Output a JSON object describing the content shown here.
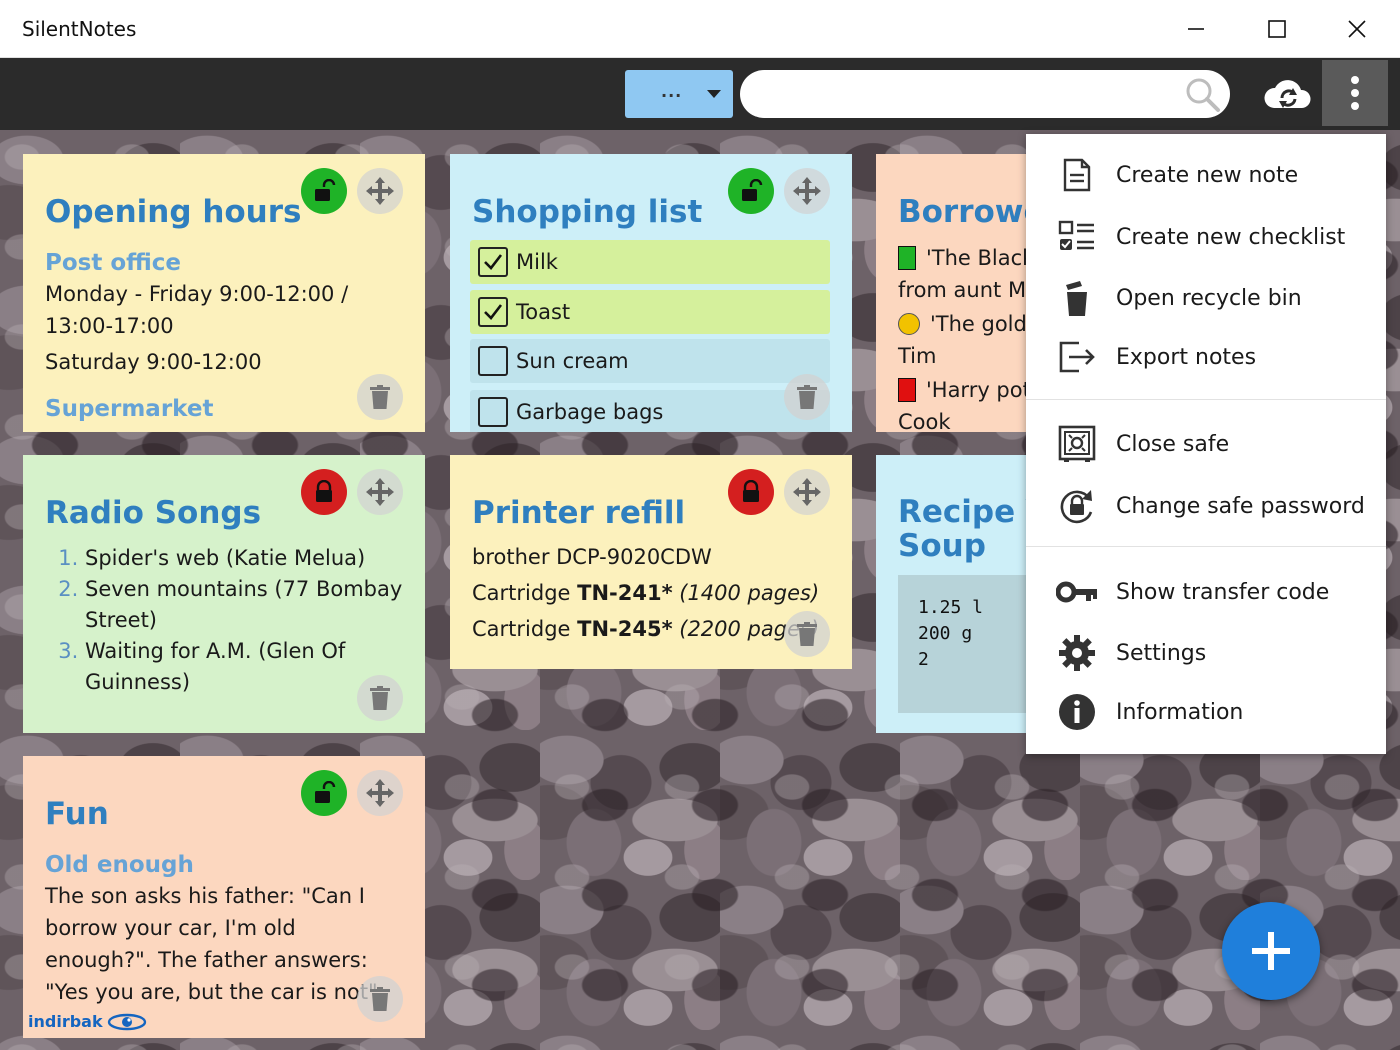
{
  "app": {
    "title": "SilentNotes"
  },
  "toolbar": {
    "filter_label": "...",
    "search_placeholder": ""
  },
  "notes": {
    "opening_hours": {
      "title": "Opening hours",
      "sub1": "Post office",
      "line1": "Monday - Friday 9:00-12:00 / 13:00-17:00",
      "line2": "Saturday 9:00-12:00",
      "sub2": "Supermarket"
    },
    "shopping_list": {
      "title": "Shopping list",
      "items": [
        {
          "label": "Milk",
          "checked": true
        },
        {
          "label": "Toast",
          "checked": true
        },
        {
          "label": "Sun cream",
          "checked": false
        },
        {
          "label": "Garbage bags",
          "checked": false
        }
      ]
    },
    "borrowed": {
      "title": "Borrowed",
      "line1": "'The Black",
      "line2": "from aunt M",
      "line3": "'The gold",
      "line4": "Tim",
      "line5": "'Harry pot",
      "line6": "Cook"
    },
    "radio_songs": {
      "title": "Radio Songs",
      "songs": [
        "Spider's web (Katie Melua)",
        "Seven mountains (77 Bombay Street)",
        "Waiting for A.M. (Glen Of Guinness)"
      ]
    },
    "printer_refill": {
      "title": "Printer refill",
      "model": "brother DCP-9020CDW",
      "cart1_prefix": "Cartridge ",
      "cart1_code": "TN-241*",
      "cart1_pages": "(1400 pages)",
      "cart2_prefix": "Cartridge ",
      "cart2_code": "TN-245*",
      "cart2_pages": "(2200 pages)"
    },
    "recipe": {
      "title_line1": "Recipe Ye",
      "title_line2": "Soup",
      "code_line1": "1.25 l",
      "code_line2": "200 g",
      "code_line3": "2"
    },
    "fun": {
      "title": "Fun",
      "sub": "Old enough",
      "text": "The son asks his father: \"Can I borrow your car, I'm old enough?\". The father answers: \"Yes you are, but the car is not\"."
    }
  },
  "menu": {
    "items": [
      {
        "label": "Create new note",
        "icon": "note-icon"
      },
      {
        "label": "Create new checklist",
        "icon": "checklist-icon"
      },
      {
        "label": "Open recycle bin",
        "icon": "recycle-bin-icon"
      },
      {
        "label": "Export notes",
        "icon": "export-icon"
      },
      {
        "label": "Close safe",
        "icon": "safe-icon"
      },
      {
        "label": "Change safe password",
        "icon": "lock-refresh-icon"
      },
      {
        "label": "Show transfer code",
        "icon": "key-icon"
      },
      {
        "label": "Settings",
        "icon": "gear-icon"
      },
      {
        "label": "Information",
        "icon": "info-icon"
      }
    ]
  },
  "watermark": {
    "text": "indirbak"
  },
  "colors": {
    "accent": "#2f7fbf",
    "fab": "#1f7fdb",
    "lock_open": "#1fb327",
    "lock_closed": "#d41f1f",
    "toolbar": "#2b2b2b"
  }
}
